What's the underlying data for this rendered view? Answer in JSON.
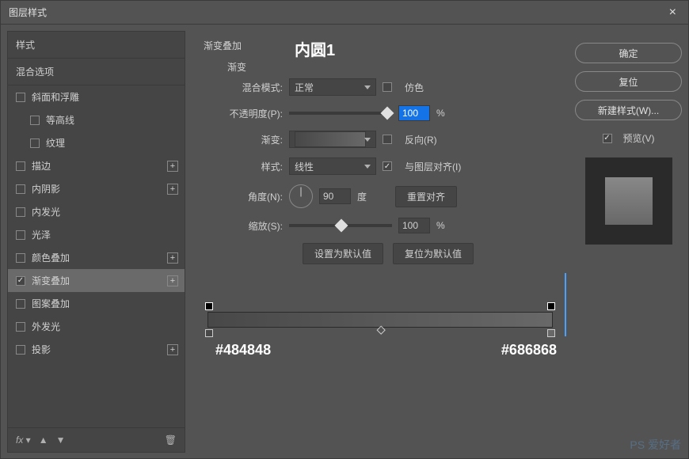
{
  "window": {
    "title": "图层样式"
  },
  "sidebar": {
    "header1": "样式",
    "header2": "混合选项",
    "items": [
      {
        "label": "斜面和浮雕",
        "checked": false,
        "plus": false
      },
      {
        "label": "等高线",
        "checked": false,
        "plus": false,
        "indent": true
      },
      {
        "label": "纹理",
        "checked": false,
        "plus": false,
        "indent": true
      },
      {
        "label": "描边",
        "checked": false,
        "plus": true
      },
      {
        "label": "内阴影",
        "checked": false,
        "plus": true
      },
      {
        "label": "内发光",
        "checked": false,
        "plus": false
      },
      {
        "label": "光泽",
        "checked": false,
        "plus": false
      },
      {
        "label": "颜色叠加",
        "checked": false,
        "plus": true
      },
      {
        "label": "渐变叠加",
        "checked": true,
        "plus": true,
        "active": true
      },
      {
        "label": "图案叠加",
        "checked": false,
        "plus": false
      },
      {
        "label": "外发光",
        "checked": false,
        "plus": false
      },
      {
        "label": "投影",
        "checked": false,
        "plus": true
      }
    ],
    "footer": {
      "fx": "fx",
      "up": "▲",
      "down": "▼",
      "trash": "🗑"
    }
  },
  "main": {
    "section_title": "渐变叠加",
    "overlay_title": "内圆1",
    "group_label": "渐变",
    "blend_label": "混合模式:",
    "blend_value": "正常",
    "dither_label": "仿色",
    "opacity_label": "不透明度(P):",
    "opacity_value": "100",
    "percent": "%",
    "gradient_label": "渐变:",
    "reverse_label": "反向(R)",
    "style_label": "样式:",
    "style_value": "线性",
    "align_label": "与图层对齐(I)",
    "angle_label": "角度(N):",
    "angle_value": "90",
    "degree": "度",
    "reset_align": "重置对齐",
    "scale_label": "缩放(S):",
    "scale_value": "100",
    "set_default": "设置为默认值",
    "reset_default": "复位为默认值",
    "color_left": "#484848",
    "color_right": "#686868"
  },
  "right": {
    "ok": "确定",
    "reset": "复位",
    "new_style": "新建样式(W)...",
    "preview": "预览(V)"
  },
  "watermark": "PS 爱好者"
}
